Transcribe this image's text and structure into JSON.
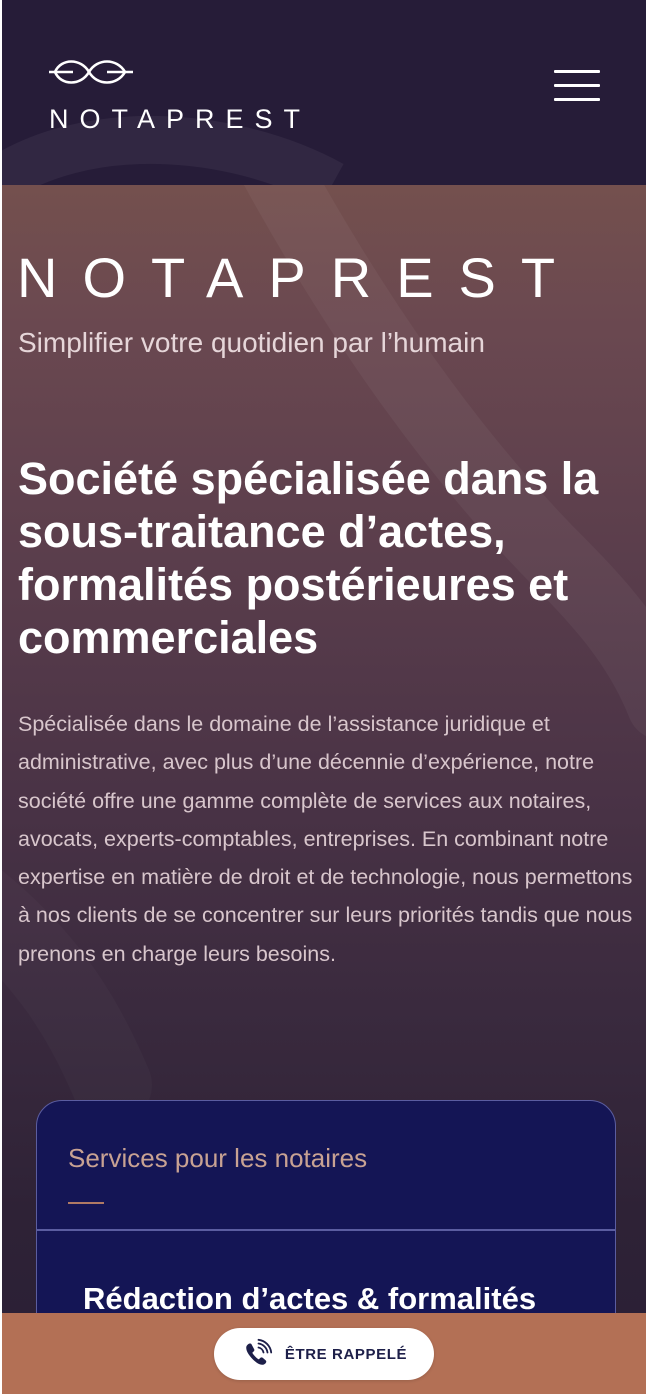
{
  "header": {
    "logo_text": "NOTAPREST",
    "logo_icon": "infinity-logo-icon",
    "menu_icon": "hamburger-menu-icon"
  },
  "hero": {
    "brand": "NOTAPREST",
    "tagline": "Simplifier votre quotidien par l’humain",
    "headline": "Société spécialisée dans la sous-traitance d’actes, formalités postérieures et commerciales",
    "intro": "Spécialisée dans le domaine de l’assistance juridique et administrative, avec plus d’une décennie d’expérience, notre société offre une gamme complète de services aux notaires, avocats, experts-comptables, entreprises. En combinant notre expertise en matière de droit et de technologie, nous permettons à nos clients de se concentrer sur leurs priorités tandis que nous prenons en charge leurs besoins."
  },
  "services": {
    "title": "Services pour les notaires",
    "first_item": "Rédaction d’actes & formalités"
  },
  "callback": {
    "label": "ÊTRE RAPPELÉ",
    "icon": "phone-ringing-icon"
  },
  "colors": {
    "header_bg": "#261c38",
    "hero_top": "#74504e",
    "hero_bottom": "#2a1f36",
    "card_bg": "#141555",
    "card_border": "#5b5da0",
    "accent_copper": "#b37055",
    "button_text": "#1d1f49"
  }
}
